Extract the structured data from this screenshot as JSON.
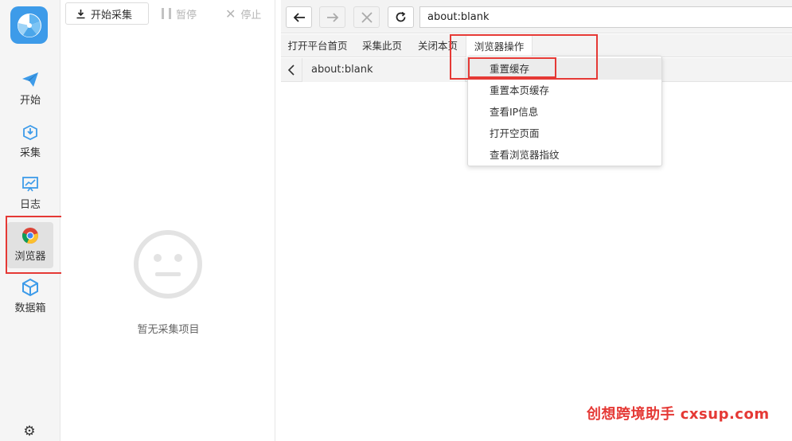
{
  "sidebar": {
    "items": [
      {
        "label": "开始",
        "icon": "paper-plane-icon"
      },
      {
        "label": "采集",
        "icon": "download-box-icon"
      },
      {
        "label": "日志",
        "icon": "presentation-board-icon"
      },
      {
        "label": "浏览器",
        "icon": "chrome-icon"
      },
      {
        "label": "数据箱",
        "icon": "cube-icon"
      }
    ],
    "settings_icon": "gear-icon"
  },
  "toolbar": {
    "start_label": "开始采集",
    "pause_label": "暂停",
    "stop_label": "停止"
  },
  "task_panel": {
    "empty_text": "暂无采集项目"
  },
  "browser": {
    "url": "about:blank",
    "tab_title": "about:blank",
    "menu": [
      "打开平台首页",
      "采集此页",
      "关闭本页",
      "浏览器操作"
    ],
    "dropdown": [
      "重置缓存",
      "重置本页缓存",
      "查看IP信息",
      "打开空页面",
      "查看浏览器指纹"
    ]
  },
  "watermark": "创想跨境助手 cxsup.com",
  "colors": {
    "accent": "#3d9be9",
    "highlight_box": "#e53935"
  }
}
